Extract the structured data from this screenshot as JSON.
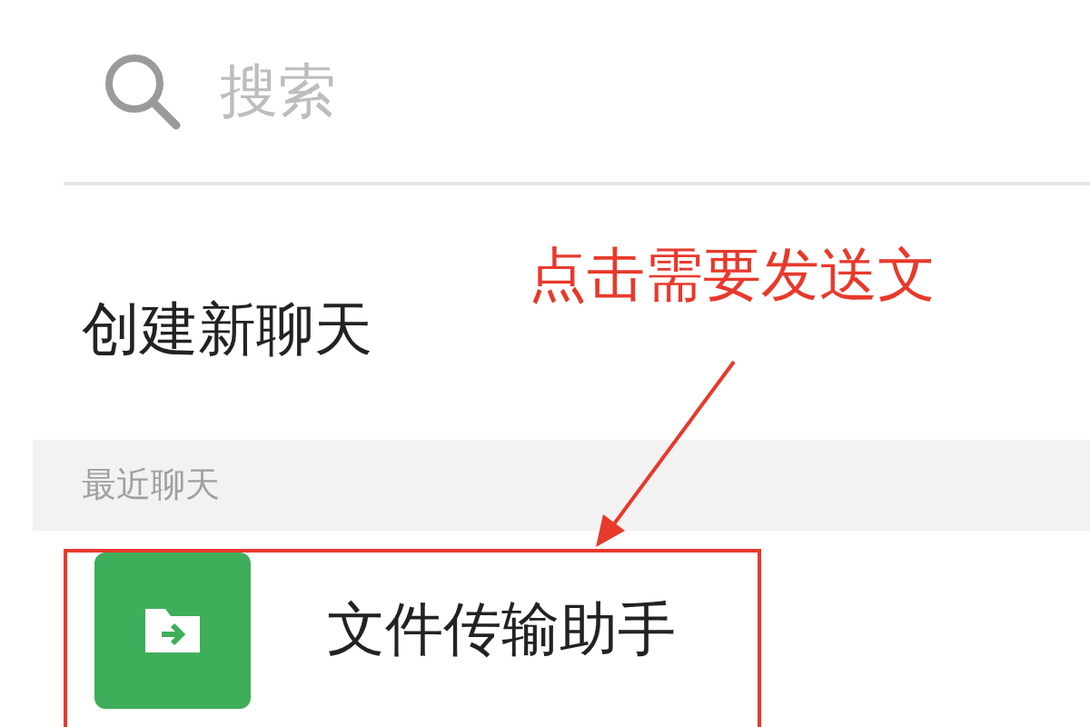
{
  "search": {
    "placeholder": "搜索"
  },
  "new_chat": {
    "label": "创建新聊天"
  },
  "annotation": {
    "text": "点击需要发送文"
  },
  "recent": {
    "header": "最近聊天",
    "chats": [
      {
        "name": "文件传输助手",
        "kind": "file",
        "highlighted": true
      }
    ]
  }
}
